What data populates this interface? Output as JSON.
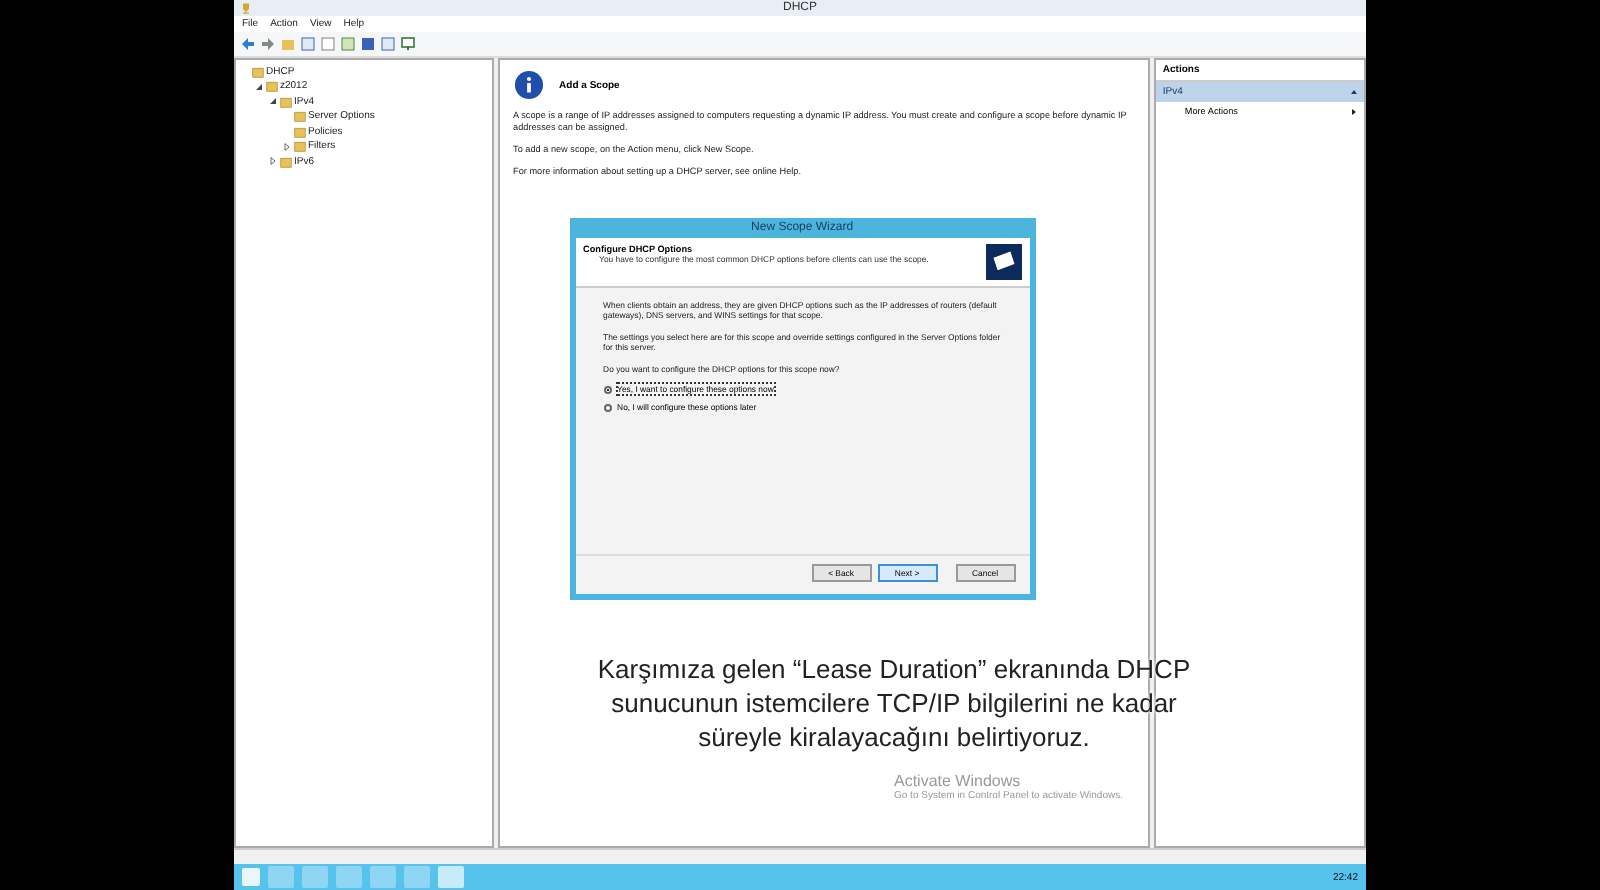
{
  "window": {
    "title": "DHCP"
  },
  "menu": [
    "File",
    "Action",
    "View",
    "Help"
  ],
  "tree": {
    "label": "DHCP",
    "children": [
      {
        "label": "z2012",
        "expanded": true,
        "children": [
          {
            "label": "IPv4",
            "expanded": true,
            "children": [
              {
                "label": "Server Options"
              },
              {
                "label": "Policies"
              },
              {
                "label": "Filters",
                "expanded": false
              }
            ]
          },
          {
            "label": "IPv6",
            "expanded": false
          }
        ]
      }
    ]
  },
  "main": {
    "heading": "Add a Scope",
    "paragraphs": [
      "A scope is a range of IP addresses assigned to computers requesting a dynamic IP address. You must create and configure a scope before dynamic IP addresses can be assigned.",
      "To add a new scope, on the Action menu, click New Scope.",
      "For more information about setting up a DHCP server, see online Help."
    ]
  },
  "wizard": {
    "title": "New Scope Wizard",
    "header_title": "Configure DHCP Options",
    "header_subtitle": "You have to configure the most common DHCP options before clients can use the scope.",
    "paragraphs": [
      "When clients obtain an address, they are given DHCP options such as the IP addresses of routers (default gateways), DNS servers, and WINS settings for that scope.",
      "The settings you select here are for this scope and override settings configured in the Server Options folder for this server."
    ],
    "question": "Do you want to configure the DHCP options for this scope now?",
    "options": [
      {
        "label": "Yes, I want to configure these options now",
        "selected": true
      },
      {
        "label": "No, I will configure these options later",
        "selected": false
      }
    ],
    "buttons": [
      {
        "label": "< Back",
        "selected": false
      },
      {
        "label": "Next >",
        "selected": true
      },
      {
        "label": "Cancel",
        "selected": false
      }
    ]
  },
  "actions": {
    "header": "Actions",
    "section": "IPv4",
    "items": [
      "More Actions"
    ]
  },
  "caption": "Karşımıza gelen “Lease Duration” ekranında DHCP sunucunun istemcilere TCP/IP bilgilerini ne kadar süreyle kiralayacağını belirtiyoruz.",
  "activation": {
    "title": "Activate Windows",
    "text": "Go to System in Control Panel to activate Windows."
  },
  "taskbar": {
    "clock": "22:42"
  }
}
